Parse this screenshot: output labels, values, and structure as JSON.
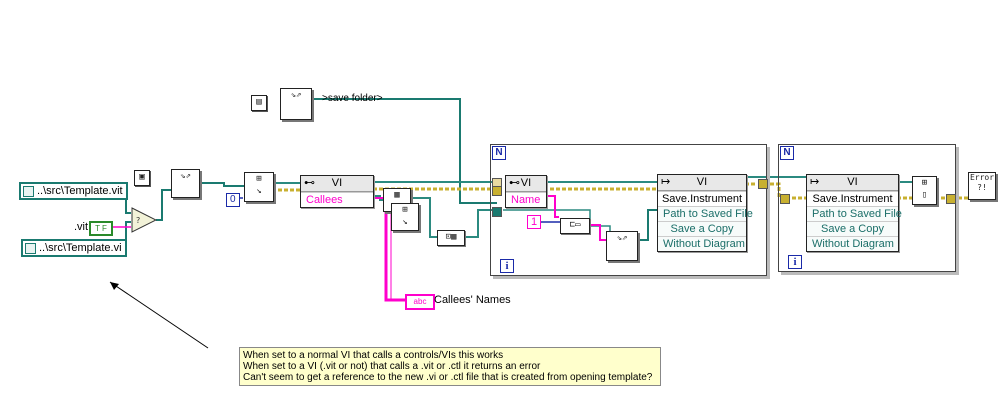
{
  "constants": {
    "template_vit_path": "..\\src\\Template.vit",
    "template_vi_path": "..\\src\\Template.vi",
    "vit_string": ".vit",
    "save_folder_label": ">save folder>",
    "zero_const": "0",
    "one_const": "1"
  },
  "nodes": {
    "open_ref_class": "VI",
    "callees_property": "Callees",
    "callees_names_indicator": "Callees' Names",
    "inner_ref_class": "VI",
    "name_property": "Name",
    "invoke1": {
      "class": "VI",
      "method": "Save.Instrument",
      "rows": [
        "Path to Saved File",
        "Save a Copy",
        "Without Diagram"
      ]
    },
    "invoke2_ref_class": "VI",
    "invoke2": {
      "class": "VI",
      "method": "Save.Instrument",
      "rows": [
        "Path to Saved File",
        "Save a Copy",
        "Without Diagram"
      ]
    },
    "error_label": "Error ?!"
  },
  "loops": {
    "loop1_count_label": "N",
    "loop1_index_label": "i",
    "loop2_count_label": "N",
    "loop2_index_label": "i"
  },
  "note": {
    "lines": [
      "When set to a normal VI that calls a controls/VIs this works",
      "When set to a VI (.vit or not) that calls a .vit or .ctl it returns an error",
      "Can't seem to get a reference to the new .vi or .ctl file that is created from opening template?"
    ]
  },
  "colors": {
    "path_wire": "#1a7a70",
    "string_wire": "#ff00cc",
    "reference_wire": "#2b8a80",
    "error_wire": "#c8b030",
    "numeric_wire": "#1a2aa8"
  }
}
